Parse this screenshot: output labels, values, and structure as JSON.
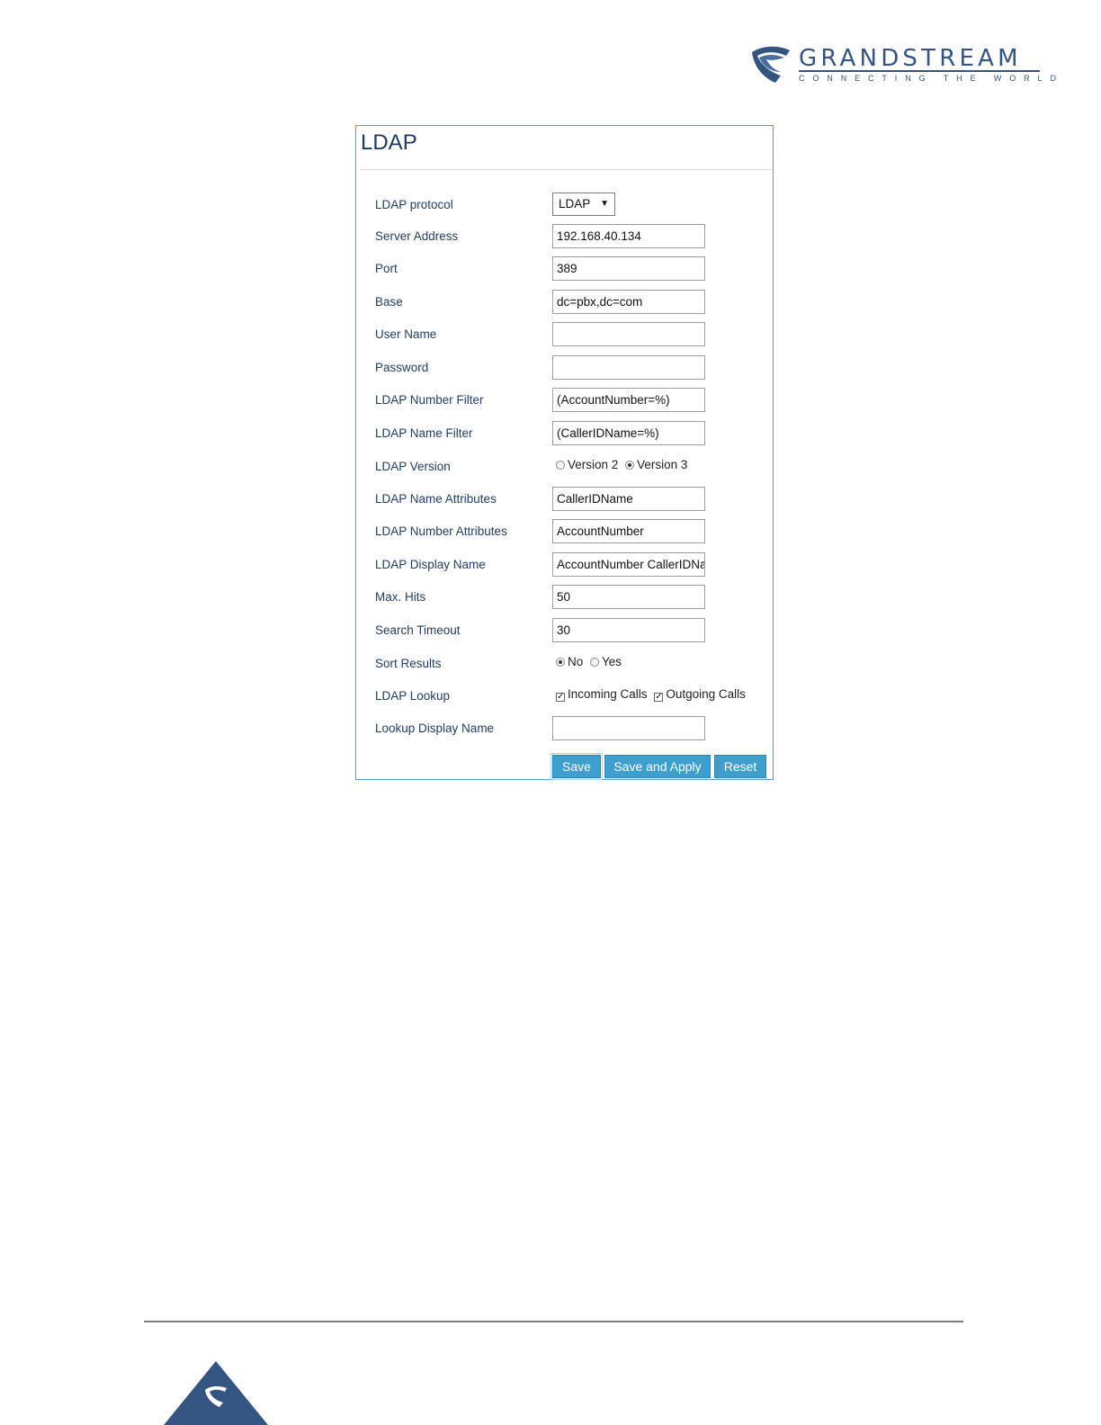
{
  "brand": {
    "name": "GRANDSTREAM",
    "tagline": "CONNECTING THE WORLD",
    "color": "#34557f"
  },
  "panel": {
    "title": "LDAP",
    "border_color": "#5b9bd5"
  },
  "form": {
    "protocol": {
      "label": "LDAP protocol",
      "value": "LDAP"
    },
    "server_address": {
      "label": "Server Address",
      "value": "192.168.40.134"
    },
    "port": {
      "label": "Port",
      "value": "389"
    },
    "base": {
      "label": "Base",
      "value": "dc=pbx,dc=com"
    },
    "user_name": {
      "label": "User Name",
      "value": ""
    },
    "password": {
      "label": "Password",
      "value": ""
    },
    "number_filter": {
      "label": "LDAP Number Filter",
      "value": "(AccountNumber=%)"
    },
    "name_filter": {
      "label": "LDAP Name Filter",
      "value": "(CallerIDName=%)"
    },
    "version": {
      "label": "LDAP Version",
      "options": [
        "Version 2",
        "Version 3"
      ],
      "selected": "Version 3"
    },
    "name_attributes": {
      "label": "LDAP Name Attributes",
      "value": "CallerIDName"
    },
    "number_attributes": {
      "label": "LDAP Number Attributes",
      "value": "AccountNumber"
    },
    "display_name": {
      "label": "LDAP Display Name",
      "value": "AccountNumber CallerIDName"
    },
    "max_hits": {
      "label": "Max. Hits",
      "value": "50"
    },
    "search_timeout": {
      "label": "Search Timeout",
      "value": "30"
    },
    "sort_results": {
      "label": "Sort Results",
      "options": [
        "No",
        "Yes"
      ],
      "selected": "No"
    },
    "lookup": {
      "label": "LDAP Lookup",
      "options": [
        "Incoming Calls",
        "Outgoing Calls"
      ],
      "checked": [
        true,
        true
      ]
    },
    "lookup_display_name": {
      "label": "Lookup Display Name",
      "value": ""
    }
  },
  "buttons": {
    "save": "Save",
    "save_apply": "Save and Apply",
    "reset": "Reset",
    "color": "#3e9fcd"
  }
}
